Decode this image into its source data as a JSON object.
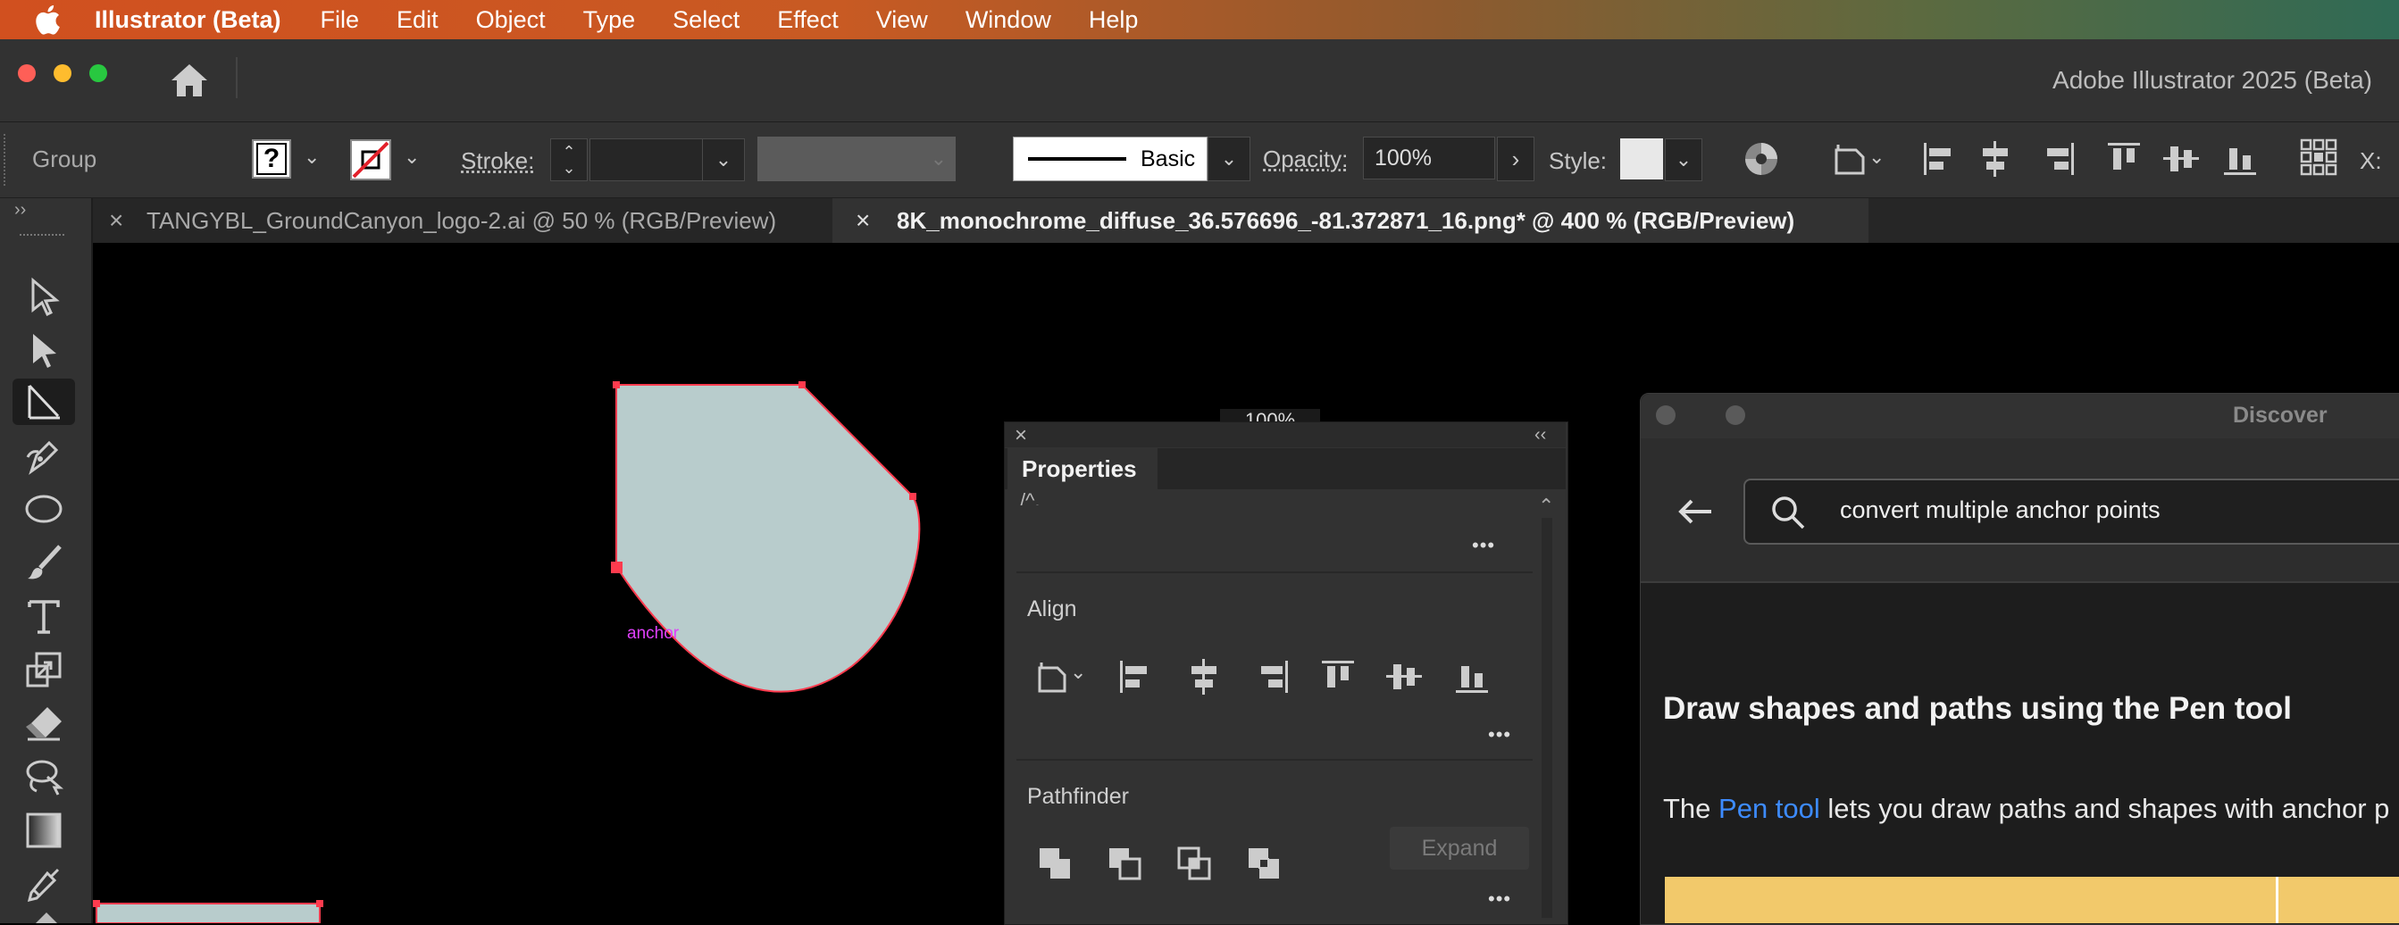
{
  "menubar": {
    "app_name": "Illustrator (Beta)",
    "items": [
      "File",
      "Edit",
      "Object",
      "Type",
      "Select",
      "Effect",
      "View",
      "Window",
      "Help"
    ]
  },
  "titlebar": {
    "window_title": "Adobe Illustrator 2025 (Beta)"
  },
  "control_bar": {
    "selection_type": "Group",
    "fill_value": "?",
    "stroke_label": "Stroke:",
    "brush_style": "Basic",
    "opacity_label": "Opacity:",
    "opacity_value": "100%",
    "style_label": "Style:",
    "x_label": "X:"
  },
  "tabs": [
    {
      "label": "TANGYBL_GroundCanyon_logo-2.ai @ 50 % (RGB/Preview)",
      "active": false
    },
    {
      "label": "8K_monochrome_diffuse_36.576696_-81.372871_16.png* @ 400 % (RGB/Preview)",
      "active": true
    }
  ],
  "canvas": {
    "shape_fill": "#b8cccc",
    "path_color": "#ff3b4e",
    "anchor_hint": "anchor",
    "anchor_hint_color": "#e040fb",
    "zoom_fragment": "100%"
  },
  "properties_panel": {
    "title": "Properties",
    "cut_text": "/^.",
    "align_title": "Align",
    "pathfinder_title": "Pathfinder",
    "expand_label": "Expand",
    "more_label": "•••"
  },
  "discover_panel": {
    "title": "Discover",
    "search_value": "convert multiple anchor points",
    "heading": "Draw shapes and paths using the Pen tool",
    "body_prefix": "The ",
    "body_link": "Pen tool",
    "body_suffix": " lets you draw paths and shapes with anchor p",
    "link_color": "#3d8bff",
    "banner_color": "#f2c96b"
  },
  "colors": {
    "menubar_start": "#d1501f",
    "panel_bg": "#323232",
    "toolbar_bg": "#323232",
    "canvas_bg": "#000000"
  }
}
